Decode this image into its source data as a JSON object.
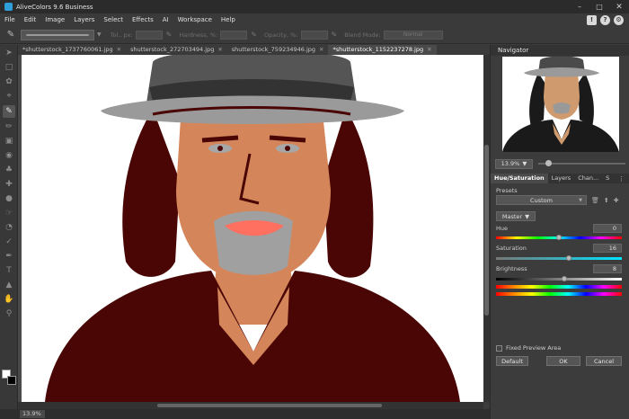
{
  "window": {
    "title": "AliveColors 9.6 Business"
  },
  "menu": [
    "File",
    "Edit",
    "Image",
    "Layers",
    "Select",
    "Effects",
    "AI",
    "Workspace",
    "Help"
  ],
  "options": {
    "tol_label": "Tol., px:",
    "hardness_label": "Hardness, %:",
    "opacity_label": "Opacity, %:",
    "blend_label": "Blend Mode:",
    "blend_value": "Normal"
  },
  "tabs": [
    {
      "label": "*shutterstock_1737760061.jpg",
      "active": false
    },
    {
      "label": "shutterstock_272703494.jpg",
      "active": false
    },
    {
      "label": "shutterstock_759234946.jpg",
      "active": false
    },
    {
      "label": "*shutterstock_1152237278.jpg",
      "active": true
    }
  ],
  "status": {
    "zoom": "13.9%"
  },
  "navigator": {
    "title": "Navigator",
    "zoom": "13.9%"
  },
  "panel_tabs": [
    "Hue/Saturation",
    "Layers",
    "Chan...",
    "S"
  ],
  "hue_sat": {
    "presets_label": "Presets",
    "preset_value": "Custom",
    "channel": "Master",
    "hue": {
      "label": "Hue",
      "value": "0",
      "level": 0.5
    },
    "saturation": {
      "label": "Saturation",
      "value": "16",
      "level": 0.58
    },
    "brightness": {
      "label": "Brightness",
      "value": "8",
      "level": 0.54
    },
    "fixed_preview": "Fixed Preview Area",
    "default_btn": "Default",
    "ok_btn": "OK",
    "cancel_btn": "Cancel"
  }
}
